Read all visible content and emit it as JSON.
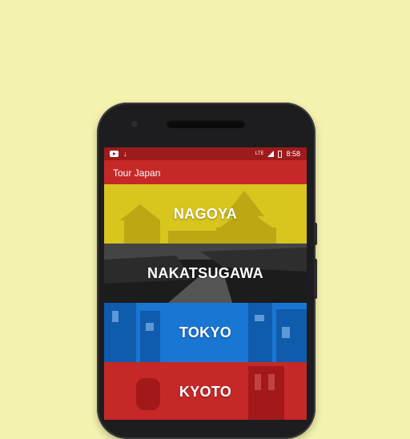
{
  "status_bar": {
    "time": "8:58",
    "network": "LTE",
    "icons": [
      "youtube-icon",
      "download-icon",
      "signal-icon",
      "battery-icon"
    ]
  },
  "app_bar": {
    "title": "Tour Japan"
  },
  "cities": [
    {
      "name": "NAGOYA",
      "color": "#d4c21c"
    },
    {
      "name": "NAKATSUGAWA",
      "color": "#1a1a1a"
    },
    {
      "name": "TOKYO",
      "color": "#1976d2"
    },
    {
      "name": "KYOTO",
      "color": "#c62828"
    }
  ],
  "colors": {
    "background": "#f5f3b0",
    "status_bar": "#9e1b1b",
    "app_bar": "#c62828"
  }
}
